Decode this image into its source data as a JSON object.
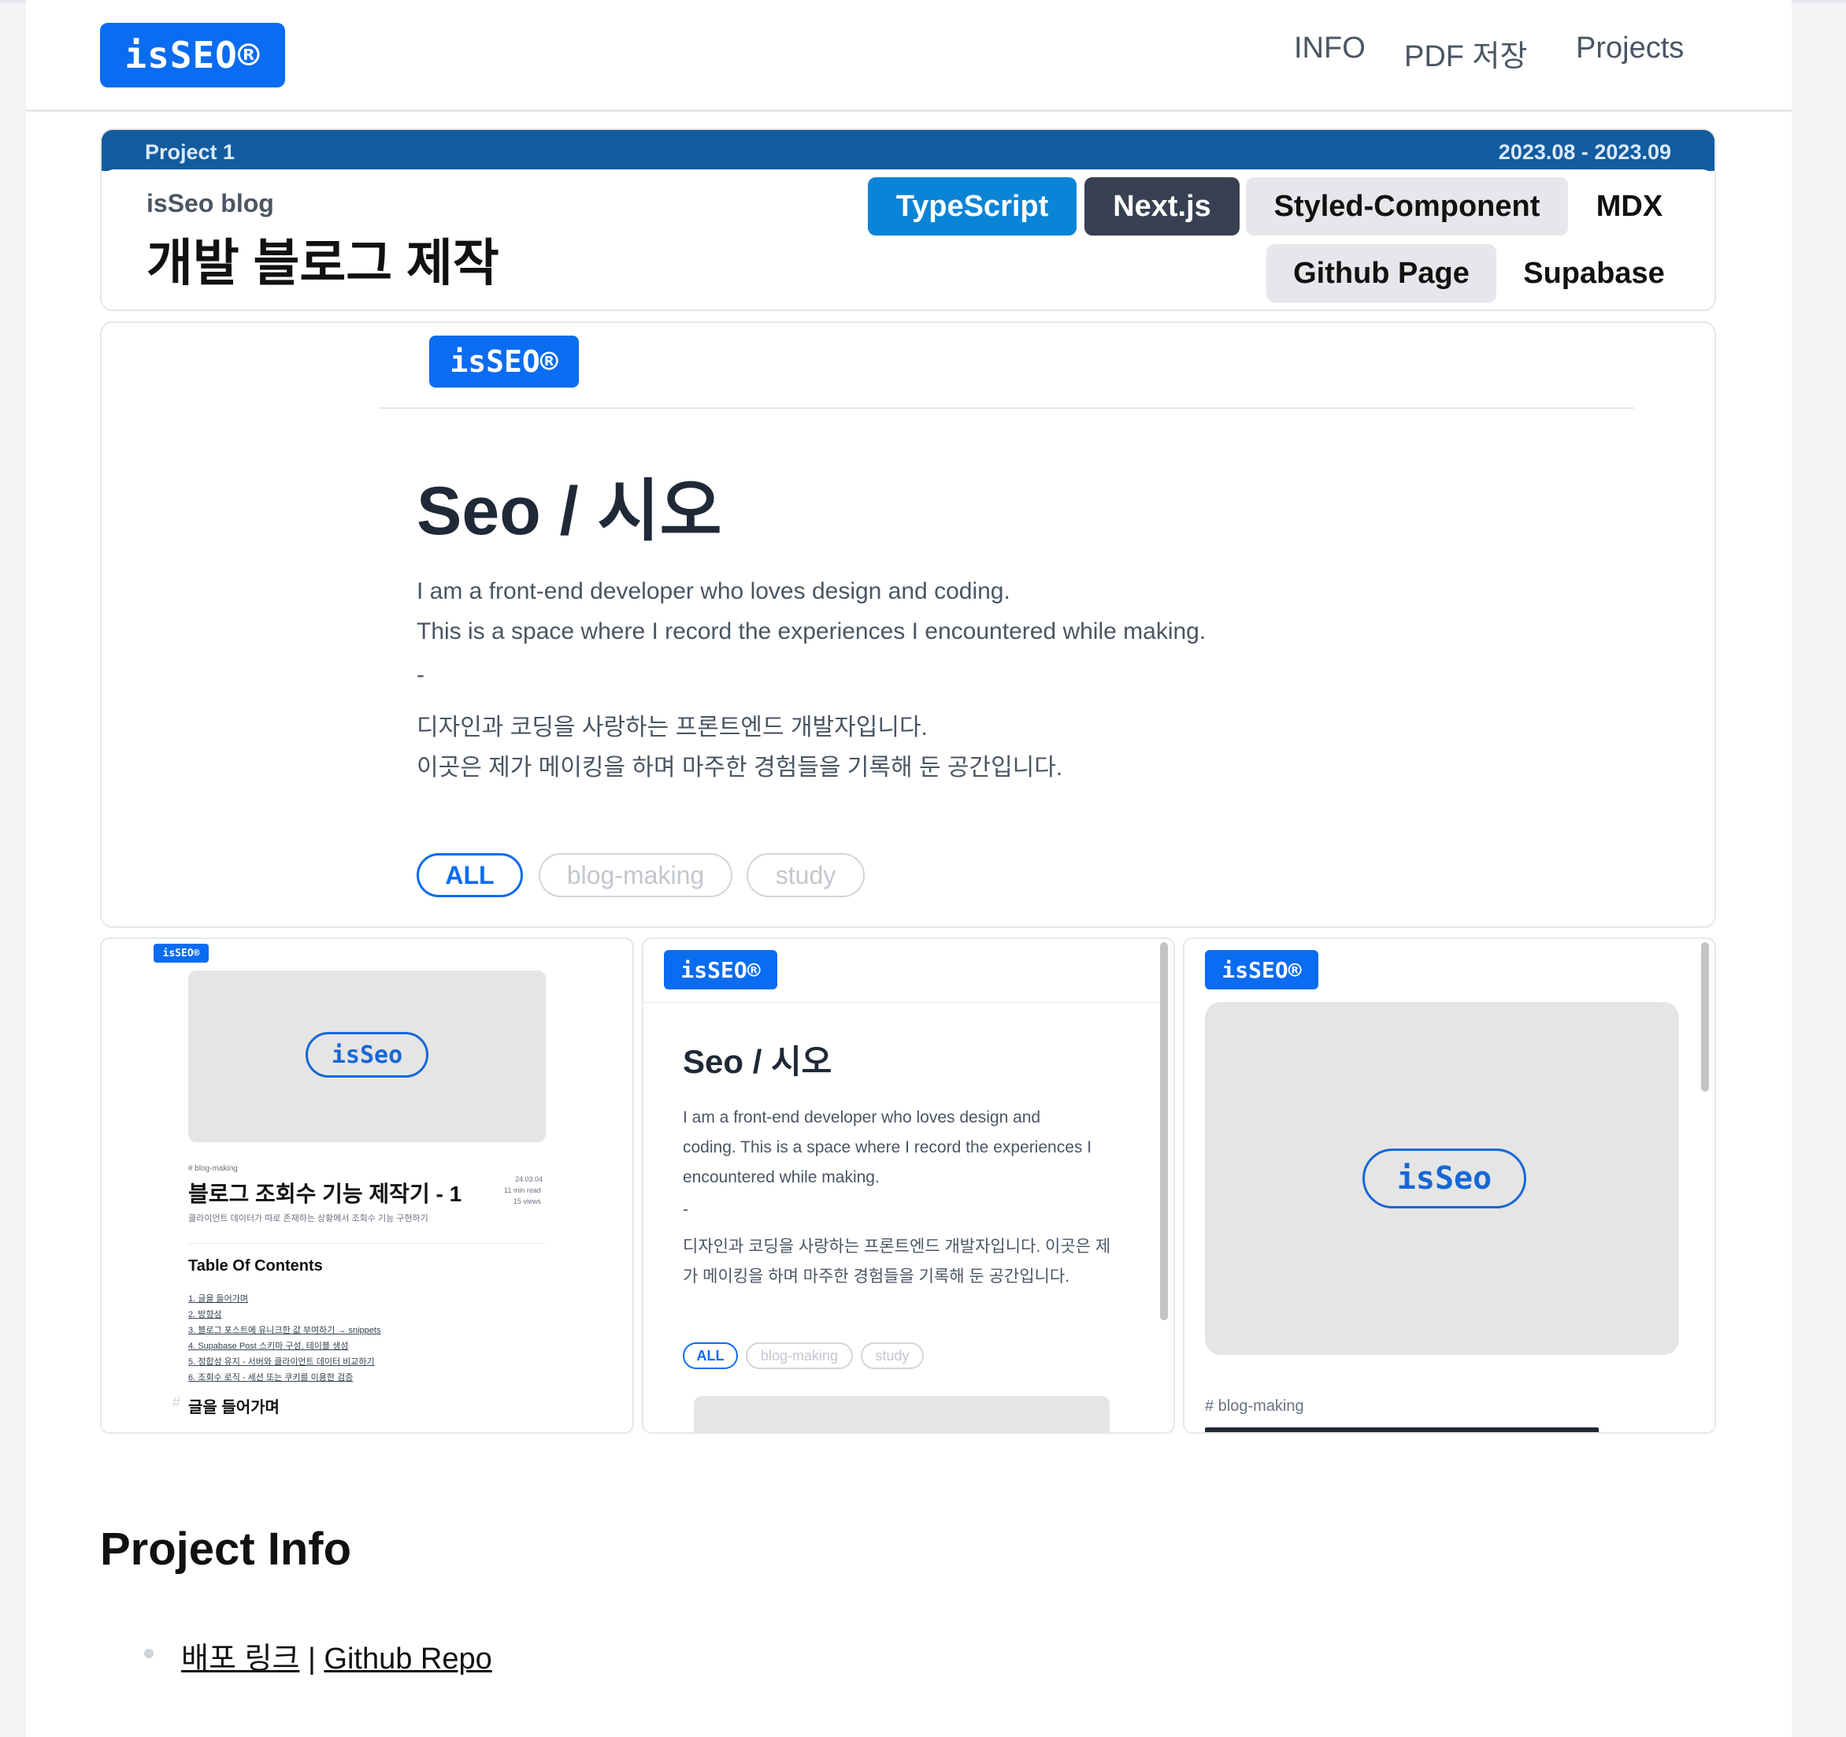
{
  "header": {
    "logo": "isSEO®",
    "nav": [
      "INFO",
      "PDF 저장",
      "Projects"
    ]
  },
  "project": {
    "number": "Project 1",
    "period": "2023.08 - 2023.09",
    "subtitle": "isSeo blog",
    "title": "개발 블로그 제작",
    "tags": [
      "TypeScript",
      "Next.js",
      "Styled-Component",
      "MDX",
      "Github Page",
      "Supabase"
    ]
  },
  "hero": {
    "logo": "isSEO®",
    "name": "Seo / 시오",
    "lines": [
      "I am a front-end developer who loves design and coding.",
      "This is a space where I record the experiences I encountered while making.",
      "-",
      "디자인과 코딩을 사랑하는 프론트엔드 개발자입니다.",
      "이곳은 제가 메이킹을 하며 마주한 경험들을 기록해 둔 공간입니다."
    ],
    "filters": [
      "ALL",
      "blog-making",
      "study"
    ]
  },
  "thumb1": {
    "logo": "isSEO®",
    "cover_label": "isSeo",
    "category": "# blog-making",
    "title": "블로그 조회수 기능 제작기 - 1",
    "date": "24.03.04",
    "read": "11 min read",
    "views": "15 views",
    "desc": "클라이언트 데이터가 따로 존재하는 상황에서 조회수 기능 구현하기",
    "toc_title": "Table Of Contents",
    "toc": [
      "1. 글을 들어가며",
      "2. 방향성",
      "3. 블로그 포스트에 유니크한 값 부여하기 → snippets",
      "4. Supabase Post 스키마 구성, 테이블 생성",
      "5. 정합성 유지 - 서버와 클라이언트 데이터 비교하기",
      "6. 조회수 로직 - 세션 또는 쿠키를 이용한 검증"
    ],
    "section": "글을 들어가며"
  },
  "thumb2": {
    "logo": "isSEO®",
    "name": "Seo / 시오",
    "lines": [
      "I am a front-end developer who loves design and",
      "coding. This is a space where I record the experiences I",
      "encountered while making.",
      "-",
      "디자인과 코딩을 사랑하는 프론트엔드 개발자입니다. 이곳은 제",
      "가 메이킹을 하며 마주한 경험들을 기록해 둔 공간입니다."
    ],
    "filters": [
      "ALL",
      "blog-making",
      "study"
    ]
  },
  "thumb3": {
    "logo": "isSEO®",
    "cover_label": "isSeo",
    "category": "# blog-making"
  },
  "info": {
    "title": "Project Info",
    "link1": "배포 링크",
    "separator": " | ",
    "link2": "Github Repo"
  },
  "colors": {
    "brand": "#0a6cf0",
    "project_bar": "#125c9f",
    "typescript": "#0a84d6",
    "nextjs": "#374151"
  }
}
